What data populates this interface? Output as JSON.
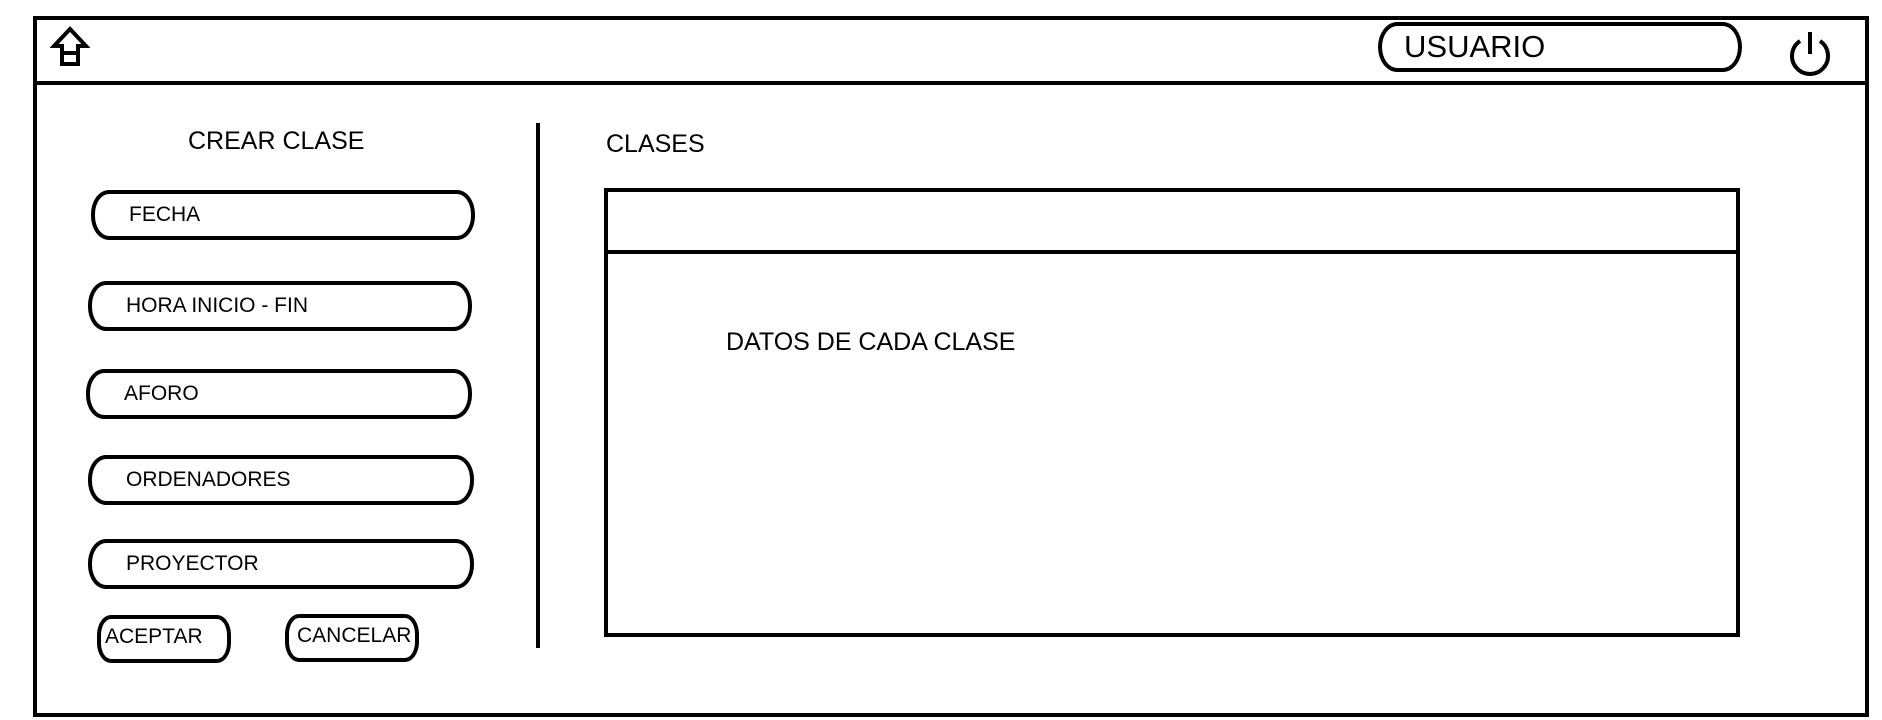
{
  "header": {
    "home_icon": "home-icon",
    "user_label": "USUARIO",
    "power_icon": "power-icon"
  },
  "create_class": {
    "title": "CREAR CLASE",
    "fields": [
      {
        "label": "FECHA"
      },
      {
        "label": "HORA INICIO - FIN"
      },
      {
        "label": "AFORO"
      },
      {
        "label": "ORDENADORES"
      },
      {
        "label": "PROYECTOR"
      }
    ],
    "accept_label": "ACEPTAR",
    "cancel_label": "CANCELAR"
  },
  "classes": {
    "title": "CLASES",
    "data_text": "DATOS DE CADA CLASE"
  }
}
